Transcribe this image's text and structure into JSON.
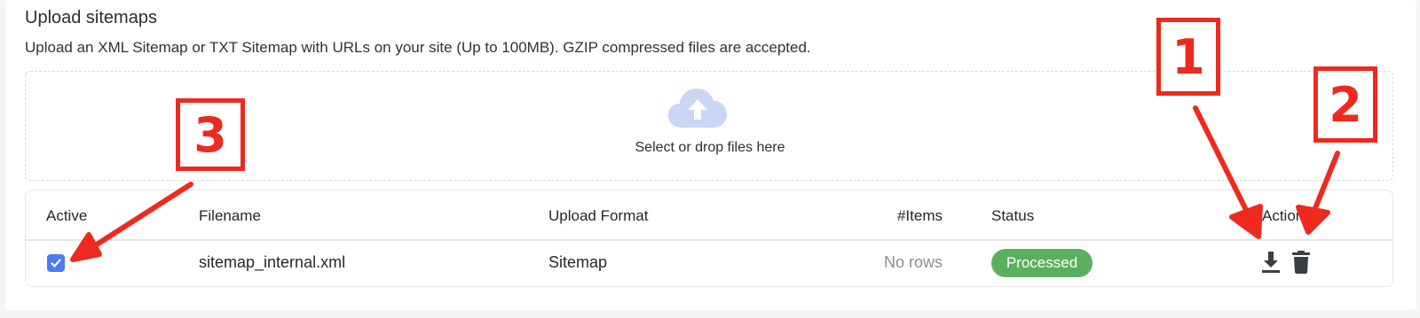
{
  "section": {
    "title": "Upload sitemaps",
    "description": "Upload an XML Sitemap or TXT Sitemap with URLs on your site (Up to 100MB). GZIP compressed files are accepted."
  },
  "dropzone": {
    "icon": "cloud-upload-icon",
    "text": "Select or drop files here"
  },
  "table": {
    "headers": {
      "active": "Active",
      "filename": "Filename",
      "format": "Upload Format",
      "items": "#Items",
      "status": "Status",
      "actions": "Actions"
    },
    "rows": [
      {
        "active": true,
        "filename": "sitemap_internal.xml",
        "format": "Sitemap",
        "items": "No rows",
        "status": "Processed",
        "actions": [
          "download-icon",
          "trash-icon"
        ]
      }
    ]
  },
  "annotations": {
    "labels": [
      "1",
      "2",
      "3"
    ],
    "color": "#ee2a1e"
  },
  "colors": {
    "checkbox": "#4a7cf0",
    "status_processed": "#5ab05e",
    "cloud": "#c9d6f5"
  }
}
